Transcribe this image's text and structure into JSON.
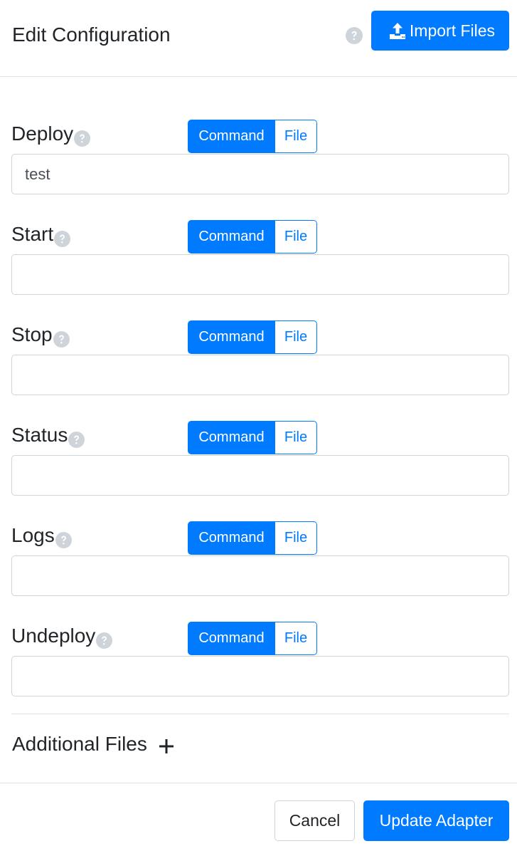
{
  "header": {
    "title": "Edit Configuration",
    "help_icon": "question-circle-icon",
    "import_button": {
      "label": "Import Files",
      "icon": "upload-icon"
    }
  },
  "sections": [
    {
      "label": "Deploy",
      "mode_options": [
        "Command",
        "File"
      ],
      "selected_mode": "Command",
      "value": "test"
    },
    {
      "label": "Start",
      "mode_options": [
        "Command",
        "File"
      ],
      "selected_mode": "Command",
      "value": ""
    },
    {
      "label": "Stop",
      "mode_options": [
        "Command",
        "File"
      ],
      "selected_mode": "Command",
      "value": ""
    },
    {
      "label": "Status",
      "mode_options": [
        "Command",
        "File"
      ],
      "selected_mode": "Command",
      "value": ""
    },
    {
      "label": "Logs",
      "mode_options": [
        "Command",
        "File"
      ],
      "selected_mode": "Command",
      "value": ""
    },
    {
      "label": "Undeploy",
      "mode_options": [
        "Command",
        "File"
      ],
      "selected_mode": "Command",
      "value": ""
    }
  ],
  "additional_files": {
    "label": "Additional Files",
    "add_icon": "plus-icon"
  },
  "footer": {
    "cancel_label": "Cancel",
    "update_label": "Update Adapter"
  },
  "colors": {
    "primary": "#007bff",
    "help_icon": "#ced4da",
    "border": "#dee2e6"
  }
}
